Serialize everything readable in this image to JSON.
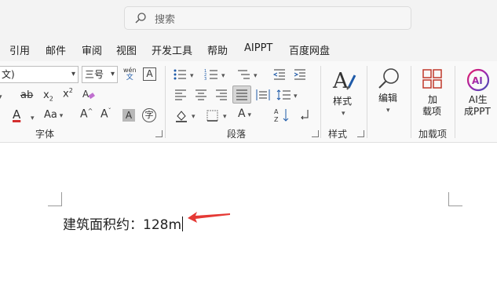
{
  "search": {
    "placeholder": "搜索"
  },
  "menu": [
    "引用",
    "邮件",
    "审阅",
    "视图",
    "开发工具",
    "帮助",
    "AIPPT",
    "百度网盘"
  ],
  "font_group": {
    "font_name": "文)",
    "font_size": "三号",
    "label": "字体"
  },
  "paragraph_group": {
    "label": "段落"
  },
  "styles_group": {
    "button_label": "样式",
    "label": "样式"
  },
  "editing": {
    "button_label": "编辑"
  },
  "addins_group": {
    "button_line1": "加",
    "button_line2": "载项",
    "label": "加载项"
  },
  "ai_button": {
    "line1": "AI生",
    "line2": "成PPT"
  },
  "document": {
    "text": "建筑面积约：128m"
  },
  "colors": {
    "annotation_arrow": "#e53935",
    "font_color_bar": "#d32f2f"
  }
}
